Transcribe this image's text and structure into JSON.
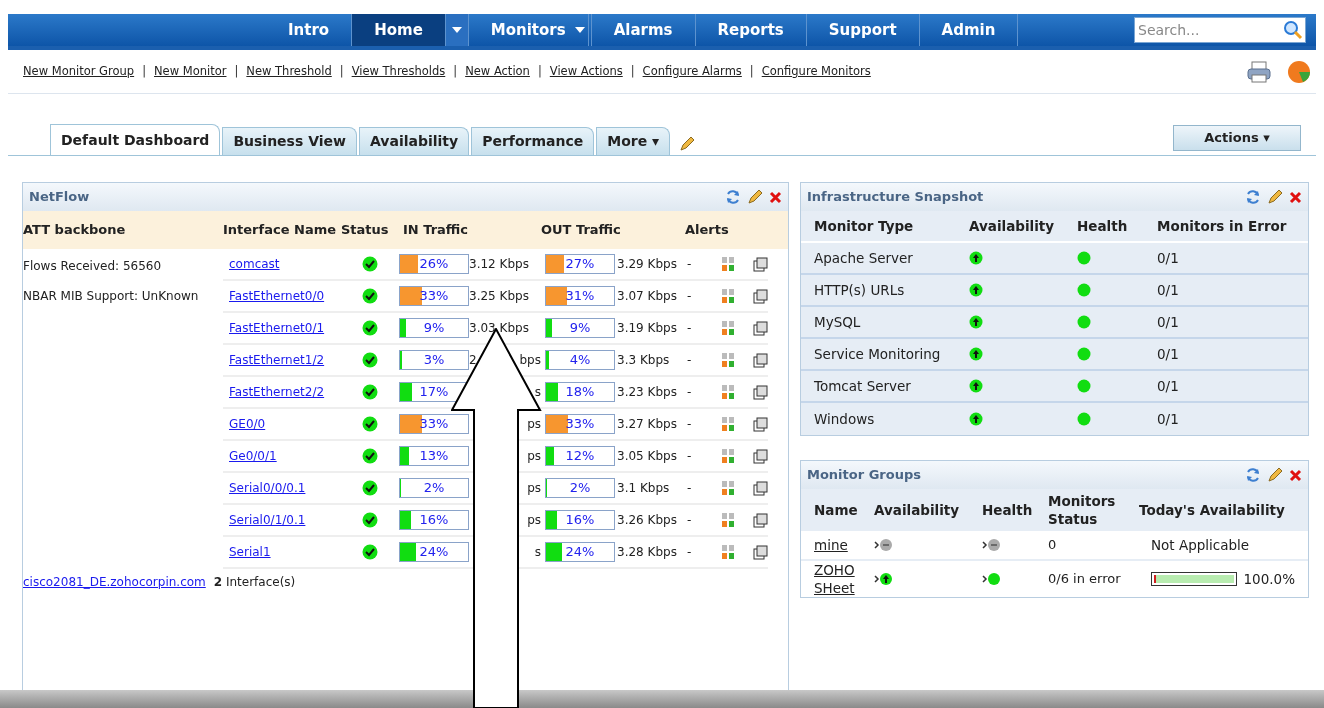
{
  "nav": {
    "items": [
      {
        "label": "Intro",
        "selected": false,
        "dropdown": false
      },
      {
        "label": "Home",
        "selected": true,
        "dropdown": true
      },
      {
        "label": "Monitors",
        "selected": false,
        "dropdown": true
      },
      {
        "label": "Alarms",
        "selected": false,
        "dropdown": false
      },
      {
        "label": "Reports",
        "selected": false,
        "dropdown": false
      },
      {
        "label": "Support",
        "selected": false,
        "dropdown": false
      },
      {
        "label": "Admin",
        "selected": false,
        "dropdown": false
      }
    ],
    "search": {
      "placeholder": "Search..."
    }
  },
  "links": [
    {
      "kind": "link",
      "label": "New Monitor Group"
    },
    {
      "kind": "separator",
      "label": "|"
    },
    {
      "kind": "link",
      "label": "New Monitor"
    },
    {
      "kind": "separator",
      "label": "|"
    },
    {
      "kind": "link",
      "label": "New Threshold"
    },
    {
      "kind": "separator",
      "label": "|"
    },
    {
      "kind": "link",
      "label": "View Thresholds"
    },
    {
      "kind": "separator",
      "label": "|"
    },
    {
      "kind": "link",
      "label": "New Action"
    },
    {
      "kind": "separator",
      "label": "|"
    },
    {
      "kind": "link",
      "label": "View Actions"
    },
    {
      "kind": "separator",
      "label": "|"
    },
    {
      "kind": "link",
      "label": "Configure Alarms"
    },
    {
      "kind": "separator",
      "label": "|"
    },
    {
      "kind": "link",
      "label": "Configure Monitors"
    }
  ],
  "tabs": [
    {
      "label": "Default Dashboard",
      "selected": true
    },
    {
      "label": "Business View",
      "selected": false
    },
    {
      "label": "Availability",
      "selected": false
    },
    {
      "label": "Performance",
      "selected": false
    },
    {
      "label": "More ▾",
      "selected": false
    }
  ],
  "actions_button": "Actions ▾",
  "netflow": {
    "title": "NetFlow",
    "columns": [
      "ATT backbone",
      "Interface Name",
      "Status",
      "IN Traffic",
      "OUT Traffic",
      "Alerts"
    ],
    "info": [
      "Flows Received: 56560",
      "NBAR MIB Support: UnKnown"
    ],
    "rows": [
      {
        "name": "comcast",
        "in_bar": {
          "text": "26%",
          "level": 0.26,
          "color": "#f7962f"
        },
        "in_rate": "3.12 Kbps",
        "out_bar": {
          "text": "27%",
          "level": 0.27,
          "color": "#f7962f"
        },
        "out_rate": "3.29 Kbps",
        "alerts": "-"
      },
      {
        "name": "FastEthernet0/0",
        "in_bar": {
          "text": "33%",
          "level": 0.33,
          "color": "#f7962f"
        },
        "in_rate": "3.25 Kbps",
        "out_bar": {
          "text": "31%",
          "level": 0.31,
          "color": "#f7962f"
        },
        "out_rate": "3.07 Kbps",
        "alerts": "-"
      },
      {
        "name": "FastEthernet0/1",
        "in_bar": {
          "text": "9%",
          "level": 0.09,
          "color": "#11dd11"
        },
        "in_rate": "3.03 Kbps",
        "out_bar": {
          "text": "9%",
          "level": 0.09,
          "color": "#11dd11"
        },
        "out_rate": "3.19 Kbps",
        "alerts": "-"
      },
      {
        "name": "FastEthernet1/2",
        "in_bar": {
          "text": "3%",
          "level": 0.03,
          "color": "#11dd11"
        },
        "in_rate": "2",
        "in_rate_end": "bps",
        "out_bar": {
          "text": "4%",
          "level": 0.04,
          "color": "#11dd11"
        },
        "out_rate": "3.3 Kbps",
        "alerts": "-"
      },
      {
        "name": "FastEthernet2/2",
        "in_bar": {
          "text": "17%",
          "level": 0.17,
          "color": "#11dd11"
        },
        "in_rate_end": "s",
        "out_bar": {
          "text": "18%",
          "level": 0.18,
          "color": "#11dd11"
        },
        "out_rate": "3.23 Kbps",
        "alerts": "-"
      },
      {
        "name": "GE0/0",
        "in_bar": {
          "text": "33%",
          "level": 0.33,
          "color": "#f7962f"
        },
        "in_rate_end": "ps",
        "out_bar": {
          "text": "33%",
          "level": 0.33,
          "color": "#f7962f"
        },
        "out_rate": "3.27 Kbps",
        "alerts": "-"
      },
      {
        "name": "Ge0/0/1",
        "in_bar": {
          "text": "13%",
          "level": 0.13,
          "color": "#11dd11"
        },
        "in_rate_end": "ps",
        "out_bar": {
          "text": "12%",
          "level": 0.12,
          "color": "#11dd11"
        },
        "out_rate": "3.05 Kbps",
        "alerts": "-"
      },
      {
        "name": "Serial0/0/0.1",
        "in_bar": {
          "text": "2%",
          "level": 0.02,
          "color": "#11dd11"
        },
        "in_rate_end": "ps",
        "out_bar": {
          "text": "2%",
          "level": 0.02,
          "color": "#11dd11"
        },
        "out_rate": "3.1 Kbps",
        "alerts": "-"
      },
      {
        "name": "Serial0/1/0.1",
        "in_bar": {
          "text": "16%",
          "level": 0.16,
          "color": "#11dd11"
        },
        "in_rate_end": "ps",
        "out_bar": {
          "text": "16%",
          "level": 0.16,
          "color": "#11dd11"
        },
        "out_rate": "3.26 Kbps",
        "alerts": "-"
      },
      {
        "name": "Serial1",
        "in_bar": {
          "text": "24%",
          "level": 0.24,
          "color": "#11dd11"
        },
        "in_rate_end": "s",
        "out_bar": {
          "text": "24%",
          "level": 0.24,
          "color": "#11dd11"
        },
        "out_rate": "3.28 Kbps",
        "alerts": "-"
      }
    ],
    "footer_link": "cisco2081_DE.zohocorpin.com",
    "footer_count": "**2** Interface(s)"
  },
  "snapshot": {
    "title": "Infrastructure Snapshot",
    "columns": [
      "Monitor Type",
      "Availability",
      "Health",
      "Monitors in Error"
    ],
    "rows": [
      {
        "type": "Apache Server",
        "errors": "0/1"
      },
      {
        "type": "HTTP(s) URLs",
        "errors": "0/1"
      },
      {
        "type": "MySQL",
        "errors": "0/1"
      },
      {
        "type": "Service Monitoring",
        "errors": "0/1"
      },
      {
        "type": "Tomcat Server",
        "errors": "0/1"
      },
      {
        "type": "Windows",
        "errors": "0/1"
      }
    ]
  },
  "groups": {
    "title": "Monitor Groups",
    "columns": [
      "Name",
      "Availability",
      "Health",
      "Monitors Status",
      "Today's Availability"
    ],
    "rows": [
      {
        "name": "mine",
        "kind": "unknown",
        "status": "0",
        "today": "Not Applicable"
      },
      {
        "name": "ZOHO SHeet",
        "kind": "up",
        "status": "0/6 in error",
        "level": 1.0,
        "today": "100.0%"
      }
    ]
  }
}
